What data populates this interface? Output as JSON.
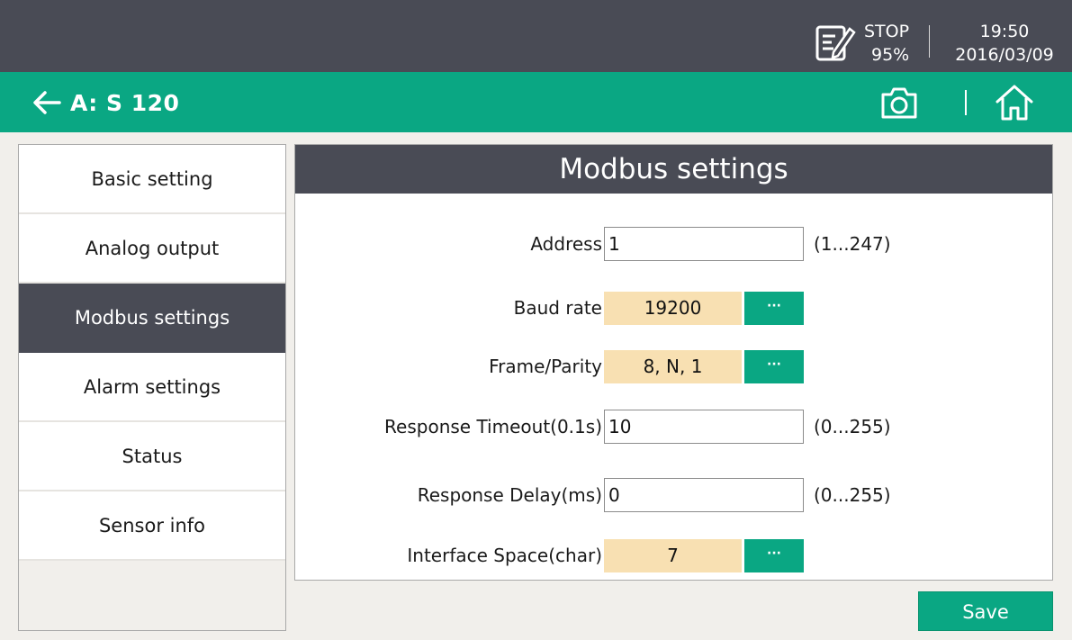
{
  "status_bar": {
    "run_state": "STOP",
    "percent": "95%",
    "time": "19:50",
    "date": "2016/03/09",
    "edit_icon": "edit-note-icon"
  },
  "title_bar": {
    "title": "A: S 120",
    "back_icon": "arrow-left-icon",
    "camera_icon": "camera-icon",
    "home_icon": "home-icon"
  },
  "sidebar": {
    "items": [
      {
        "label": "Basic setting"
      },
      {
        "label": "Analog output"
      },
      {
        "label": "Modbus settings",
        "active": true
      },
      {
        "label": "Alarm settings"
      },
      {
        "label": "Status"
      },
      {
        "label": "Sensor info"
      }
    ]
  },
  "main": {
    "title": "Modbus settings",
    "fields": {
      "address": {
        "label": "Address",
        "value": "1",
        "range": "(1...247)"
      },
      "baud_rate": {
        "label": "Baud rate",
        "value": "19200",
        "button": "···"
      },
      "frame_parity": {
        "label": "Frame/Parity",
        "value": "8, N, 1",
        "button": "···"
      },
      "response_timeout": {
        "label": "Response Timeout(0.1s)",
        "value": "10",
        "range": "(0...255)"
      },
      "response_delay": {
        "label": "Response Delay(ms)",
        "value": "0",
        "range": "(0...255)"
      },
      "interface_space": {
        "label": "Interface Space(char)",
        "value": "7",
        "button": "···"
      }
    }
  },
  "footer": {
    "save_label": "Save"
  },
  "colors": {
    "accent_green": "#0aa783",
    "dark_gray": "#494b55",
    "select_fill": "#f8e0b2",
    "background": "#f1efeb"
  }
}
